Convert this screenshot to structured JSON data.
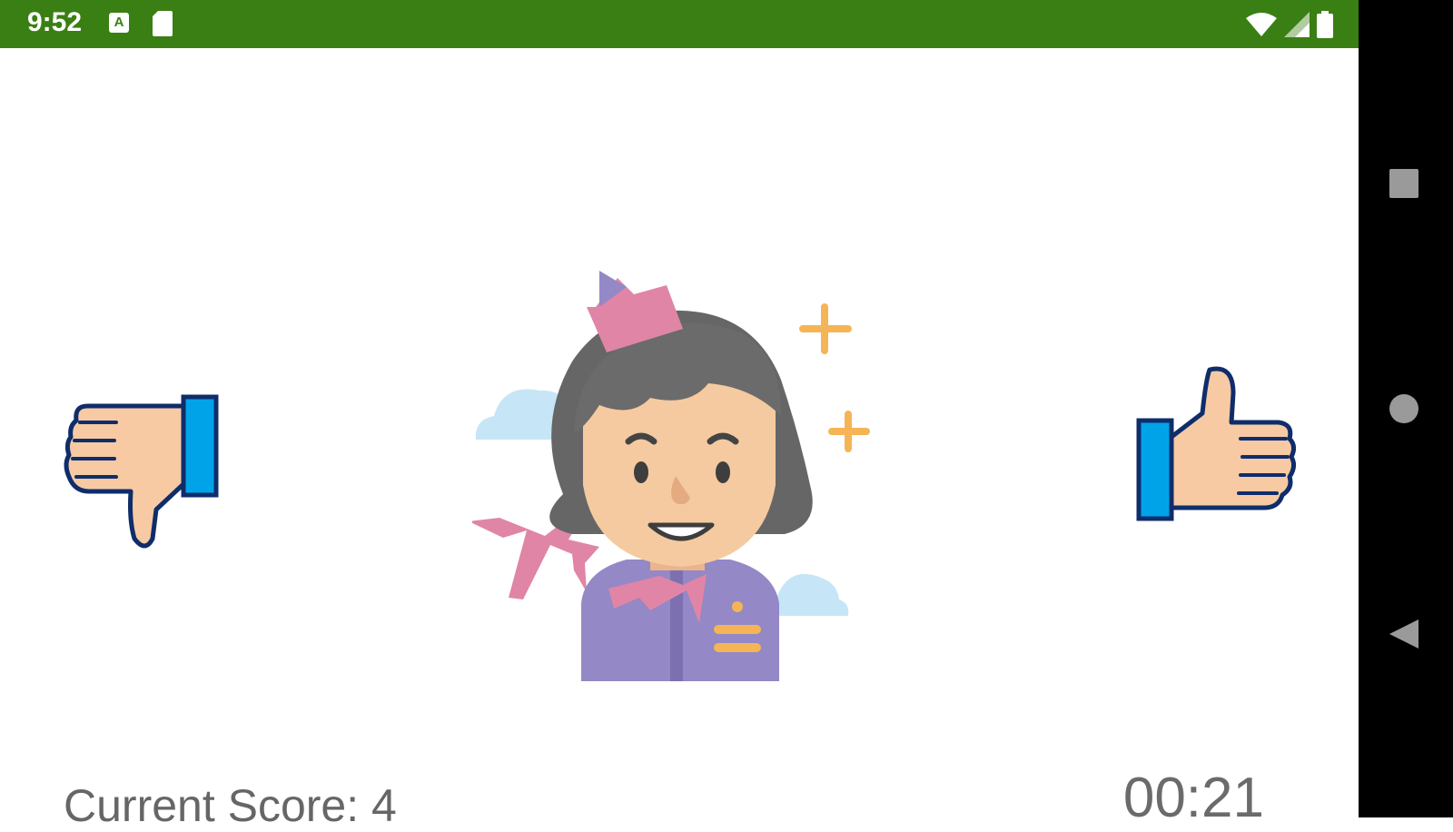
{
  "status_bar": {
    "time": "9:52",
    "background": "#3a7f13",
    "left_icons": [
      "a-icon",
      "sd-card-icon"
    ],
    "right_icons": [
      "wifi-icon",
      "cellular-signal-icon",
      "battery-icon"
    ]
  },
  "nav_bar": {
    "buttons": [
      "recents-square-icon",
      "home-circle-icon",
      "back-triangle-icon"
    ]
  },
  "game": {
    "card_image": "flight-attendant-illustration",
    "dislike_icon": "thumbs-down-icon",
    "like_icon": "thumbs-up-icon",
    "score_text": "Current Score: 4",
    "timer_text": "00:21"
  }
}
